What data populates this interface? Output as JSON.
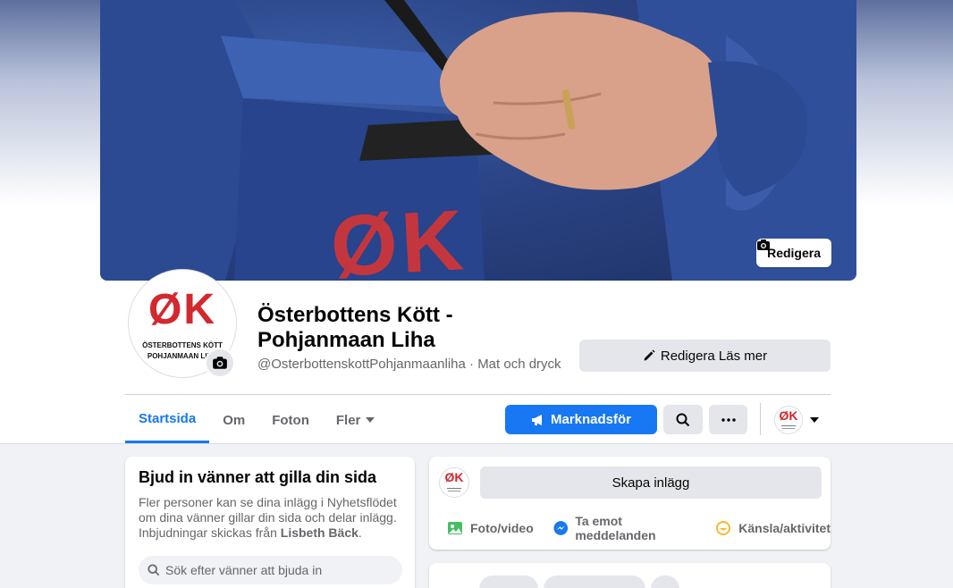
{
  "cover": {
    "edit_label": "Redigera",
    "logo_text": "ØK"
  },
  "profile": {
    "logo_mark": "ØK",
    "logo_line1": "ÖSTERBOTTENS KÖTT",
    "logo_line2": "POHJANMAAN LIHA",
    "title_line1": "Österbottens Kött -",
    "title_line2": "Pohjanmaan Liha",
    "subtitle": "@OsterbottenskottPohjanmaanliha · Mat och dryck",
    "edit_more_label": "Redigera Läs mer"
  },
  "tabs": [
    {
      "label": "Startsida",
      "active": true
    },
    {
      "label": "Om"
    },
    {
      "label": "Foton"
    },
    {
      "label": "Fler"
    }
  ],
  "actions": {
    "promote_label": "Marknadsför"
  },
  "invite": {
    "title": "Bjud in vänner att gilla din sida",
    "text": "Fler personer kan se dina inlägg i Nyhetsflödet om dina vänner gillar din sida och delar inlägg. Inbjudningar skickas från ",
    "sender": "Lisbeth Bäck",
    "text_end": ".",
    "search_placeholder": "Sök efter vänner att bjuda in"
  },
  "create_post": {
    "button_label": "Skapa inlägg",
    "photo_label": "Foto/video",
    "messages_label": "Ta emot meddelanden",
    "feeling_label": "Känsla/aktivitet"
  },
  "colors": {
    "primary": "#1877f2",
    "logo_red": "#d2282e"
  }
}
